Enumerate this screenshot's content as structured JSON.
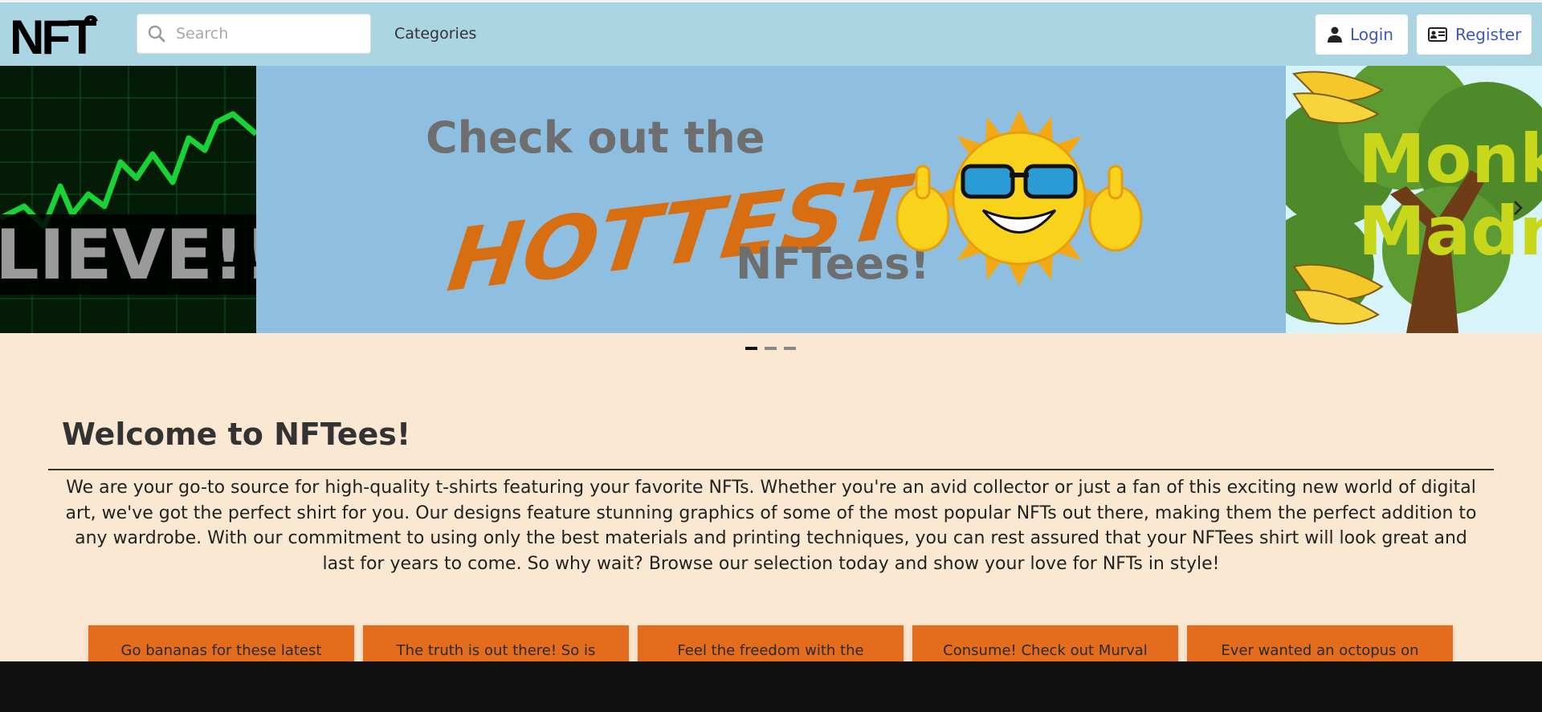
{
  "navbar": {
    "logo_text": "NFT",
    "search_placeholder": "Search",
    "categories_label": "Categories",
    "login_label": "Login",
    "register_label": "Register"
  },
  "carousel": {
    "left_slide_text": "LIEVE!!!",
    "center_slide": {
      "line1": "Check out the",
      "line2": "HOTTEST",
      "line3": "NFTees!"
    },
    "right_slide": {
      "line1": "Monk",
      "line2": "Madn"
    },
    "slide_count": 3,
    "active_index": 0
  },
  "welcome": {
    "title": "Welcome to NFTees!",
    "body": "We are your go-to source for high-quality t-shirts featuring your favorite NFTs. Whether you're an avid collector or just a fan of this exciting new world of digital art, we've got the perfect shirt for you. Our designs feature stunning graphics of some of the most popular NFTs out there, making them the perfect addition to any wardrobe. With our commitment to using only the best materials and printing techniques, you can rest assured that your NFTees shirt will look great and last for years to come. So why wait? Browse our selection today and show your love for NFTs in style!"
  },
  "cards": [
    {
      "label": "Go bananas for these latest"
    },
    {
      "label": "The truth is out there! So is"
    },
    {
      "label": "Feel the freedom with the"
    },
    {
      "label": "Consume! Check out Murval"
    },
    {
      "label": "Ever wanted an octopus on"
    }
  ],
  "colors": {
    "navbar": "#acd5e4",
    "page_bg": "#fbe8d3",
    "card_orange": "#e36c1d",
    "link_blue": "#3d57c0",
    "hottest_orange": "#d86e12"
  }
}
